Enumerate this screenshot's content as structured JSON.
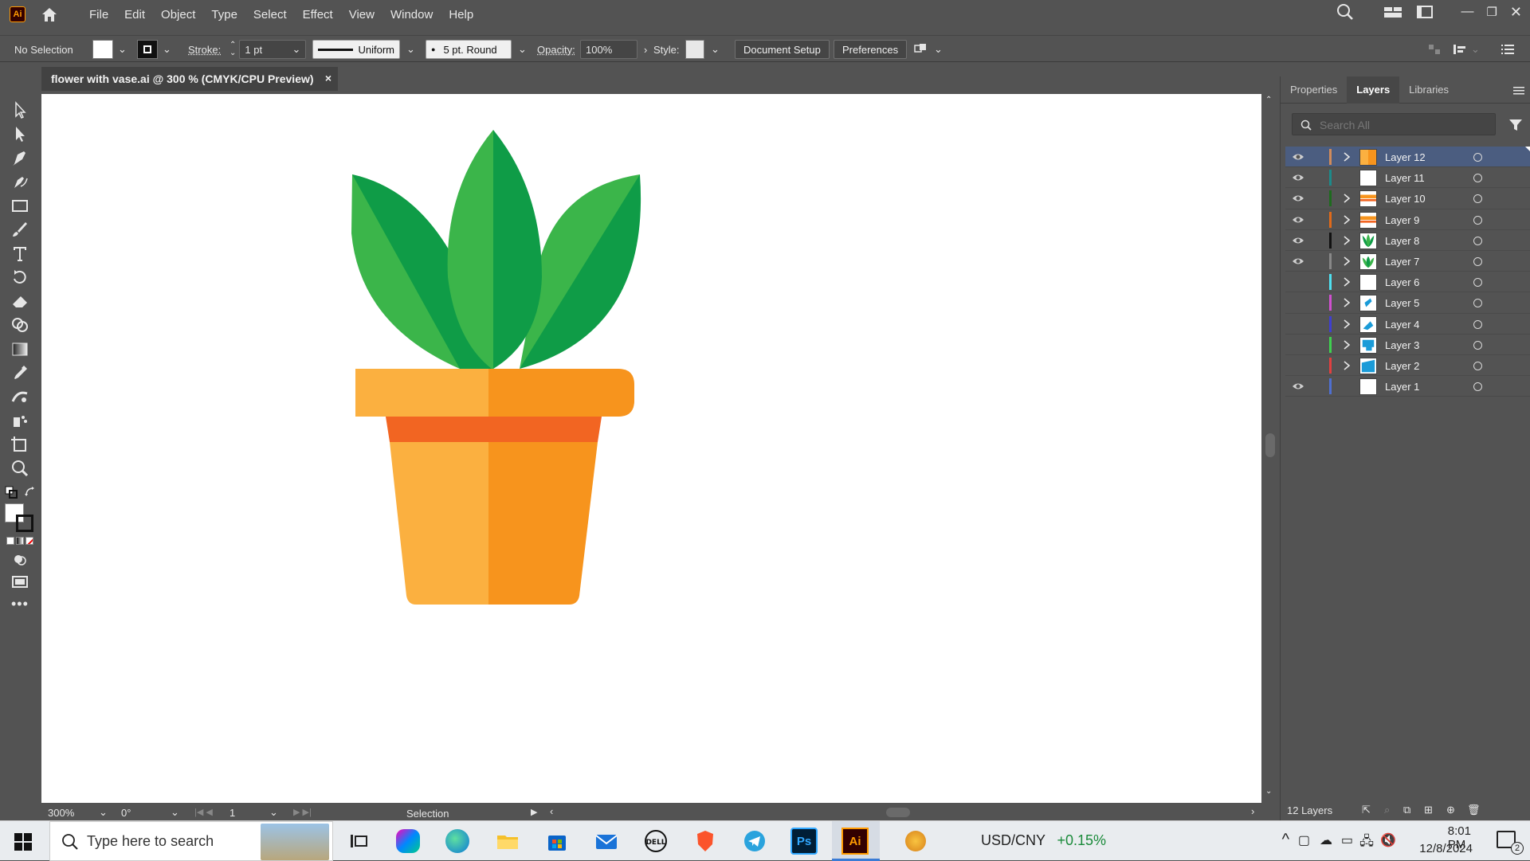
{
  "app": {
    "logo_text": "Ai"
  },
  "menu": [
    "File",
    "Edit",
    "Object",
    "Type",
    "Select",
    "Effect",
    "View",
    "Window",
    "Help"
  ],
  "control_bar": {
    "selection_label": "No Selection",
    "stroke_label": "Stroke:",
    "stroke_value": "1 pt",
    "profile_label": "Uniform",
    "brush_label": "5 pt. Round",
    "opacity_label": "Opacity:",
    "opacity_value": "100%",
    "style_label": "Style:",
    "doc_setup": "Document Setup",
    "preferences": "Preferences"
  },
  "document_tab": {
    "title": "flower with vase.ai @ 300 % (CMYK/CPU Preview)",
    "close": "×"
  },
  "status": {
    "zoom": "300%",
    "rotation": "0°",
    "artboard": "1",
    "tool": "Selection"
  },
  "panel": {
    "tabs": [
      "Properties",
      "Layers",
      "Libraries"
    ],
    "active_tab": "Layers",
    "search_placeholder": "Search All",
    "layer_count": "12 Layers",
    "layers": [
      {
        "name": "Layer 12",
        "visible": true,
        "color": "#d08b5b",
        "expand": true,
        "selected": true,
        "thumb": "orange"
      },
      {
        "name": "Layer 11",
        "visible": true,
        "color": "#1d8a8a",
        "expand": false,
        "selected": false,
        "thumb": "white"
      },
      {
        "name": "Layer 10",
        "visible": true,
        "color": "#1e6b1e",
        "expand": true,
        "selected": false,
        "thumb": "orangestripe"
      },
      {
        "name": "Layer 9",
        "visible": true,
        "color": "#e06a1a",
        "expand": true,
        "selected": false,
        "thumb": "orangestripe"
      },
      {
        "name": "Layer 8",
        "visible": true,
        "color": "#111111",
        "expand": true,
        "selected": false,
        "thumb": "leaves"
      },
      {
        "name": "Layer 7",
        "visible": true,
        "color": "#888888",
        "expand": true,
        "selected": false,
        "thumb": "leaves2"
      },
      {
        "name": "Layer 6",
        "visible": false,
        "color": "#4fe0f0",
        "expand": true,
        "selected": false,
        "thumb": "white"
      },
      {
        "name": "Layer 5",
        "visible": false,
        "color": "#d050d0",
        "expand": true,
        "selected": false,
        "thumb": "blue1"
      },
      {
        "name": "Layer 4",
        "visible": false,
        "color": "#3f3fd0",
        "expand": true,
        "selected": false,
        "thumb": "blue2"
      },
      {
        "name": "Layer 3",
        "visible": false,
        "color": "#3fd04f",
        "expand": true,
        "selected": false,
        "thumb": "blue3"
      },
      {
        "name": "Layer 2",
        "visible": false,
        "color": "#e04040",
        "expand": true,
        "selected": false,
        "thumb": "blue4"
      },
      {
        "name": "Layer 1",
        "visible": true,
        "color": "#4f6fd0",
        "expand": false,
        "selected": false,
        "thumb": "white"
      }
    ]
  },
  "taskbar": {
    "search_placeholder": "Type here to search",
    "currency": "USD/CNY",
    "currency_change": "+0.15%",
    "time": "8:01 PM",
    "date": "12/8/2024",
    "notifications": "2"
  }
}
